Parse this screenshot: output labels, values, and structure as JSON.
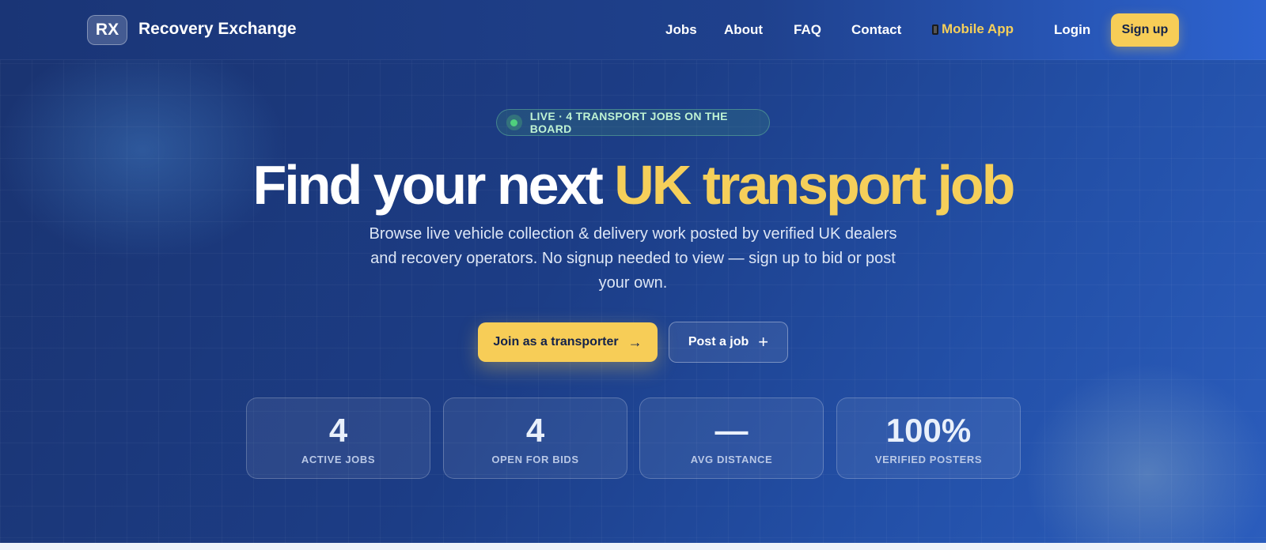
{
  "nav": {
    "logo_text": "RX",
    "brand": "Recovery Exchange",
    "links": [
      "Jobs",
      "About",
      "FAQ",
      "Contact"
    ],
    "mobile_app": "Mobile App",
    "login": "Login",
    "signup": "Sign up"
  },
  "hero": {
    "badge": "LIVE · 4 TRANSPORT JOBS ON THE BOARD",
    "headline_main": "Find your next ",
    "headline_accent": "UK transport job",
    "subtitle": "Browse live vehicle collection & delivery work posted by verified UK dealers and recovery operators. No signup needed to view — sign up to bid or post your own.",
    "cta_primary": "Join as a transporter",
    "cta_secondary": "Post a job"
  },
  "stats": [
    {
      "value": "4",
      "label": "ACTIVE JOBS"
    },
    {
      "value": "4",
      "label": "OPEN FOR BIDS"
    },
    {
      "value": "—",
      "label": "AVG DISTANCE"
    },
    {
      "value": "100%",
      "label": "VERIFIED POSTERS"
    }
  ],
  "colors": {
    "accent": "#f5cf5a",
    "background": "#1c3d86",
    "live_green": "#4fd07d"
  },
  "icons": {
    "mobile_app": "phone-icon",
    "cta_primary": "arrow-right-icon",
    "cta_secondary": "plus-icon",
    "badge": "live-dot-icon"
  }
}
